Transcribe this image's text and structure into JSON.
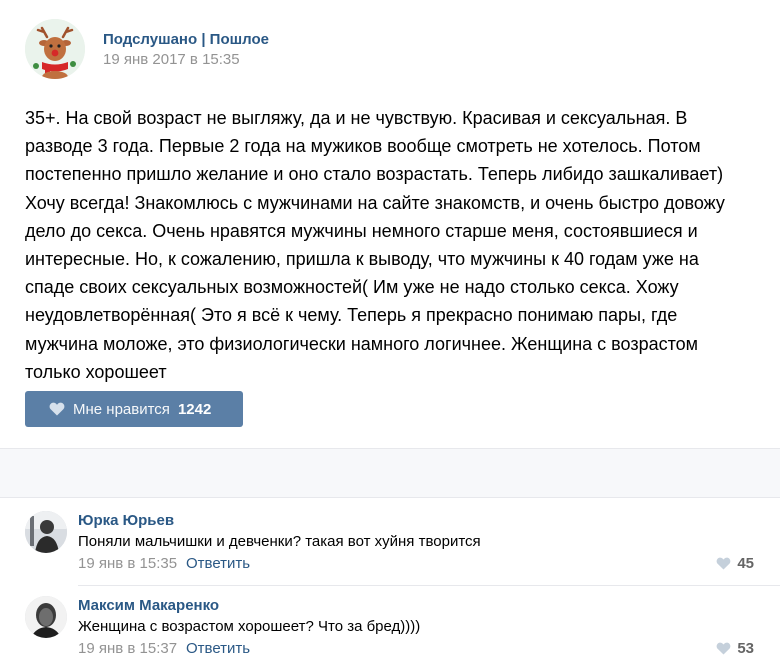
{
  "post": {
    "author": "Подслушано | Пошлое",
    "date": "19 янв 2017 в 15:35",
    "text": "35+. На свой возраст не выгляжу, да и не чувствую. Красивая и сексуальная. В\nразводе 3 года. Первые 2 года на мужиков вообще смотреть не хотелось. Потом\nпостепенно пришло желание и оно стало возрастать. Теперь либидо зашкаливает)\nХочу всегда! Знакомлюсь с мужчинами на сайте знакомств, и очень быстро довожу\nдело до секса. Очень нравятся мужчины немного старше меня, состоявшиеся и\nинтересные. Но, к сожалению, пришла к выводу, что мужчины к 40 годам уже на\nспаде своих сексуальных возможностей( Им уже не надо столько секса. Хожу\nнеудовлетворённая( Это я всё к чему. Теперь я прекрасно понимаю пары, где\nмужчина моложе, это физиологически намного логичнее. Женщина с возрастом\nтолько хорошеет",
    "like_label": "Мне нравится",
    "like_count": "1242",
    "avatar_icon": "reindeer-icon"
  },
  "comments": [
    {
      "author": "Юрка Юрьев",
      "text": "Поняли мальчишки и девченки? такая вот хуйня творится",
      "date": "19 янв в 15:35",
      "reply": "Ответить",
      "likes": "45"
    },
    {
      "author": "Максим Макаренко",
      "text": "Женщина с возрастом хорошеет? Что за бред))))",
      "date": "19 янв в 15:37",
      "reply": "Ответить",
      "likes": "53"
    }
  ],
  "colors": {
    "link": "#2a5885",
    "like_button": "#5b7fa6",
    "muted": "#939393"
  }
}
